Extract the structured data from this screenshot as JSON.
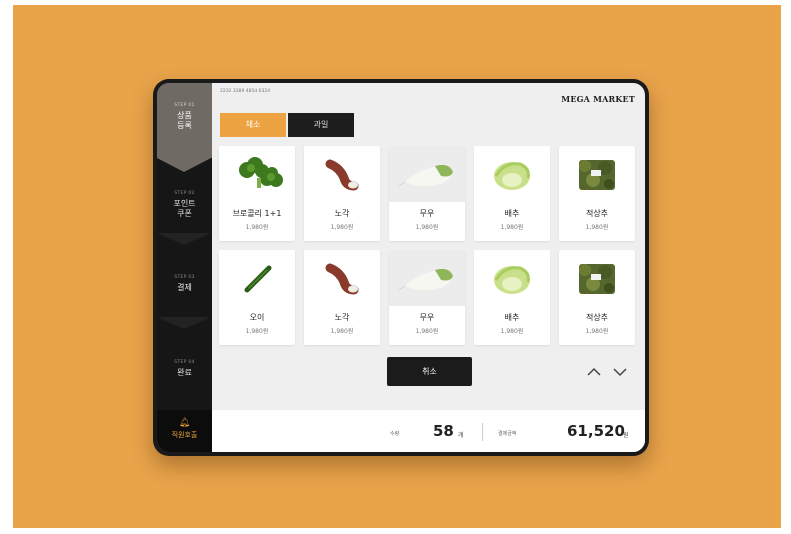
{
  "device_id": "2232 3389 485d 6324",
  "brand": "MEGA MARKET",
  "sidebar": {
    "steps": [
      {
        "num": "STEP 01",
        "label_l1": "상품",
        "label_l2": "등록"
      },
      {
        "num": "STEP 02",
        "label_l1": "포인트",
        "label_l2": "쿠폰"
      },
      {
        "num": "STEP 03",
        "label_l1": "결제",
        "label_l2": ""
      },
      {
        "num": "STEP 04",
        "label_l1": "완료",
        "label_l2": ""
      }
    ],
    "staff_call": "직원호출"
  },
  "tabs": [
    {
      "label": "채소",
      "active": true
    },
    {
      "label": "과일",
      "active": false
    }
  ],
  "products": [
    {
      "name": "브로콜리 1+1",
      "price": "1,980원",
      "icon": "broccoli-image"
    },
    {
      "name": "노각",
      "price": "1,980원",
      "icon": "nogak-image"
    },
    {
      "name": "무우",
      "price": "1,980원",
      "icon": "radish-image"
    },
    {
      "name": "배추",
      "price": "1,980원",
      "icon": "cabbage-image"
    },
    {
      "name": "적상추",
      "price": "1,980원",
      "icon": "red-lettuce-image"
    },
    {
      "name": "오이",
      "price": "1,980원",
      "icon": "cucumber-image"
    },
    {
      "name": "노각",
      "price": "1,980원",
      "icon": "nogak-image"
    },
    {
      "name": "무우",
      "price": "1,980원",
      "icon": "radish-image"
    },
    {
      "name": "배추",
      "price": "1,980원",
      "icon": "cabbage-image"
    },
    {
      "name": "적상추",
      "price": "1,980원",
      "icon": "red-lettuce-image"
    }
  ],
  "cancel_label": "취소",
  "summary": {
    "qty_label": "수량",
    "qty_value": "58",
    "qty_unit": "개",
    "amount_label": "결제금액",
    "amount_value": "61,520",
    "amount_unit": "원"
  },
  "colors": {
    "accent": "#eea342",
    "background": "#e9a44a",
    "dark": "#1b1b1b"
  }
}
